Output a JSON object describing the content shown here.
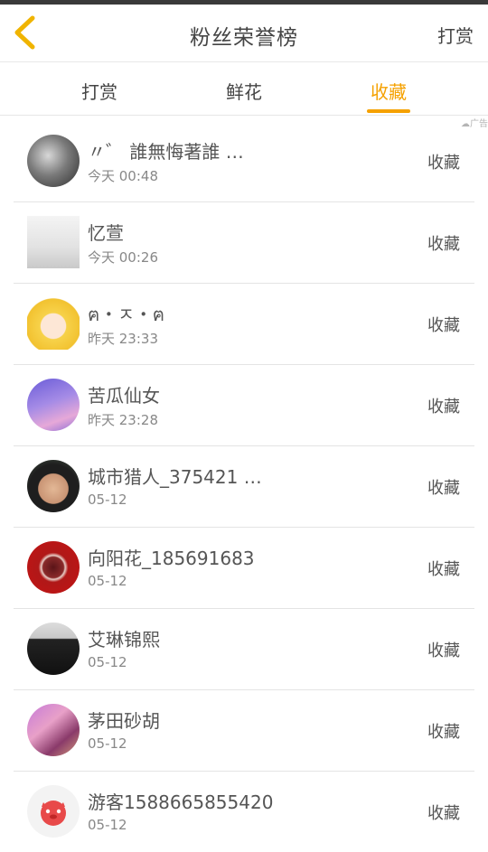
{
  "header": {
    "title": "粉丝荣誉榜",
    "right_action": "打赏"
  },
  "tabs": [
    {
      "label": "打赏",
      "active": false
    },
    {
      "label": "鲜花",
      "active": false
    },
    {
      "label": "收藏",
      "active": true
    }
  ],
  "ad_mark": "广告",
  "accent_color": "#f5a100",
  "fans": [
    {
      "name": "〃゛ 誰無悔著誰 …",
      "time": "今天 00:48",
      "action": "收藏"
    },
    {
      "name": "忆萱",
      "time": "今天 00:26",
      "action": "收藏"
    },
    {
      "name": "ฅ・ㅈ・ฅ",
      "time": "昨天 23:33",
      "action": "收藏"
    },
    {
      "name": "苦瓜仙女",
      "time": "昨天 23:28",
      "action": "收藏"
    },
    {
      "name": "城市猎人_375421 …",
      "time": "05-12",
      "action": "收藏"
    },
    {
      "name": "向阳花_185691683",
      "time": "05-12",
      "action": "收藏"
    },
    {
      "name": "艾琳锦熙",
      "time": "05-12",
      "action": "收藏"
    },
    {
      "name": "茅田砂胡",
      "time": "05-12",
      "action": "收藏"
    },
    {
      "name": "游客1588665855420",
      "time": "05-12",
      "action": "收藏"
    }
  ]
}
